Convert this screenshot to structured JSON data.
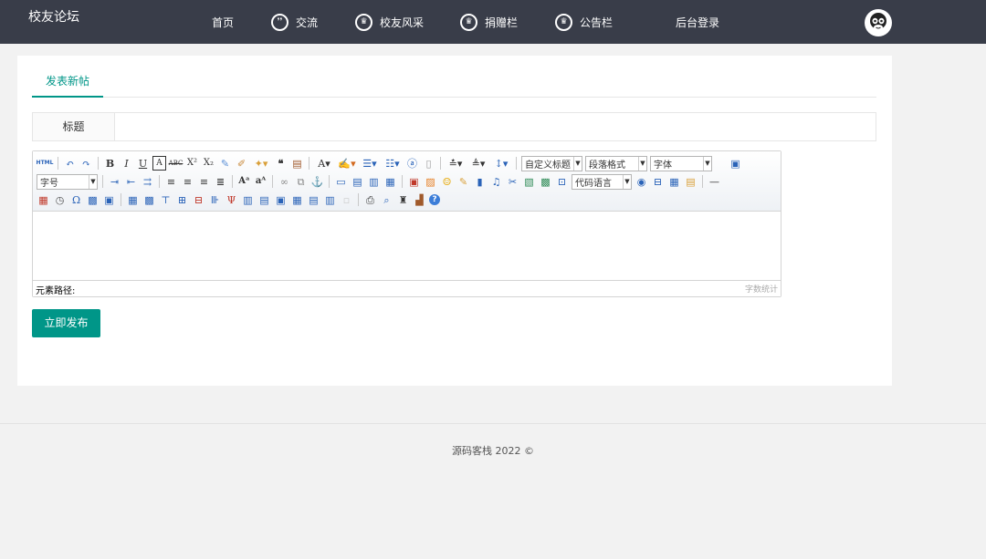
{
  "header": {
    "brand": "校友论坛",
    "nav": [
      {
        "label": "首页",
        "icon": ""
      },
      {
        "label": "交流",
        "icon": "chat-icon"
      },
      {
        "label": "校友风采",
        "icon": "crown-icon"
      },
      {
        "label": "捐赠栏",
        "icon": "crown-icon"
      },
      {
        "label": "公告栏",
        "icon": "crown-icon"
      },
      {
        "label": "后台登录",
        "icon": ""
      }
    ],
    "avatar_icon": "monkey-avatar-icon"
  },
  "page": {
    "tab": "发表新帖",
    "title_label": "标题",
    "title_value": "",
    "publish_label": "立即发布"
  },
  "editor": {
    "selects": {
      "custom_title": "自定义标题",
      "paragraph": "段落格式",
      "font_family": "字体",
      "font_size": "字号",
      "code_lang": "代码语言"
    },
    "element_path": "元素路径:",
    "word_count": "字数统计",
    "html_label": "HTML"
  },
  "footer": {
    "text": "源码客栈   2022 ©"
  },
  "colors": {
    "header_bg": "#393d49",
    "accent": "#009688"
  }
}
